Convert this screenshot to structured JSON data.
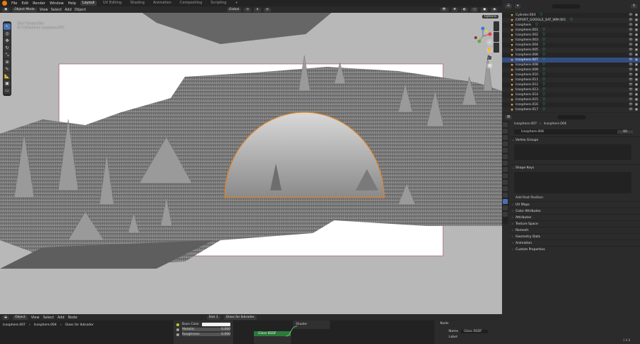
{
  "topbar": {
    "menus": [
      "File",
      "Edit",
      "Render",
      "Window",
      "Help"
    ],
    "workspaces": [
      "Layout",
      "UV Editing",
      "Shading",
      "Animation",
      "Compositing",
      "Scripting"
    ],
    "active_workspace": "Layout",
    "add_tab": "+",
    "scene": "Scene",
    "view_layer": "ViewLayer"
  },
  "viewport_header": {
    "mode": "Object Mode",
    "menus": [
      "View",
      "Select",
      "Add",
      "Object"
    ],
    "transform": "Global",
    "options": "Options"
  },
  "viewport_info": {
    "line1": "User Perspective",
    "line2": "(1) Collection | Icosphere.007"
  },
  "outliner": {
    "search_placeholder": "",
    "items": [
      {
        "name": "Cylinder.004",
        "selected": false
      },
      {
        "name": "EXPORT_GOOGLE_SAT_WM.001",
        "selected": false
      },
      {
        "name": "Icosphere",
        "selected": false
      },
      {
        "name": "Icosphere.001",
        "selected": false
      },
      {
        "name": "Icosphere.002",
        "selected": false
      },
      {
        "name": "Icosphere.003",
        "selected": false
      },
      {
        "name": "Icosphere.004",
        "selected": false
      },
      {
        "name": "Icosphere.005",
        "selected": false
      },
      {
        "name": "Icosphere.006",
        "selected": false
      },
      {
        "name": "Icosphere.007",
        "selected": true
      },
      {
        "name": "Icosphere.008",
        "selected": false
      },
      {
        "name": "Icosphere.009",
        "selected": false
      },
      {
        "name": "Icosphere.010",
        "selected": false
      },
      {
        "name": "Icosphere.011",
        "selected": false
      },
      {
        "name": "Icosphere.012",
        "selected": false
      },
      {
        "name": "Icosphere.013",
        "selected": false
      },
      {
        "name": "Icosphere.014",
        "selected": false
      },
      {
        "name": "Icosphere.015",
        "selected": false
      },
      {
        "name": "Icosphere.016",
        "selected": false
      },
      {
        "name": "Icosphere.017",
        "selected": false
      }
    ]
  },
  "properties": {
    "breadcrumb_object": "Icosphere.007",
    "breadcrumb_mesh": "Icosphere.004",
    "mesh_name": "Icosphere.004",
    "user_count": "60",
    "sections": {
      "vertex_groups": "Vertex Groups",
      "shape_keys": "Shape Keys",
      "add_rest_position": "Add Rest Position",
      "uv_maps": "UV Maps",
      "color_attributes": "Color Attributes",
      "attributes": "Attributes",
      "texture_space": "Texture Space",
      "remesh": "Remesh",
      "geometry_data": "Geometry Data",
      "animation": "Animation",
      "custom_properties": "Custom Properties"
    }
  },
  "node_editor": {
    "header_mode": "Object",
    "menus": [
      "View",
      "Select",
      "Add",
      "Node"
    ],
    "slot": "Slot 1",
    "material": "Glass for Ikbrader",
    "breadcrumb": [
      "Icosphere.007",
      "Icosphere.004",
      "Glass for Ikbrader"
    ],
    "bsdf_rows": [
      {
        "label": "Base Color",
        "value": ""
      },
      {
        "label": "Metallic",
        "value": "0.000"
      },
      {
        "label": "Roughness",
        "value": "0.000"
      }
    ],
    "output_node_title": "Glass BSDF",
    "shader_label": "Shader",
    "side_tab": "Node",
    "name_label": "Name",
    "name_value": "Glass BSDF",
    "label_label": "Label"
  },
  "status_bar": {
    "version": "3.6.8"
  },
  "colors": {
    "accent": "#4772b3",
    "selection_outline": "#e0852b",
    "viewport_bg": "#b8b8b8"
  }
}
